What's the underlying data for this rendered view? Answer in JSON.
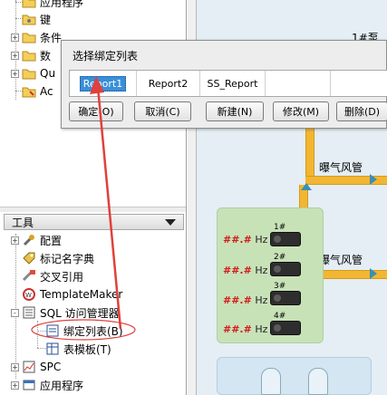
{
  "tree_top": {
    "items": [
      {
        "label": "应用程序",
        "expander": ""
      },
      {
        "label": "键",
        "expander": ""
      },
      {
        "label": "条件",
        "expander": "+"
      },
      {
        "label": "数",
        "expander": "+"
      },
      {
        "label": "Qu",
        "expander": "+"
      },
      {
        "label": "Ac",
        "expander": ""
      }
    ]
  },
  "tools_panel": {
    "header": "工具",
    "items": [
      {
        "label": "配置",
        "expander": "+"
      },
      {
        "label": "标记名字典",
        "expander": ""
      },
      {
        "label": "交叉引用",
        "expander": ""
      },
      {
        "label": "TemplateMaker",
        "expander": ""
      },
      {
        "label": "SQL 访问管理器",
        "expander": "-"
      },
      {
        "label": "绑定列表(B)",
        "expander": ""
      },
      {
        "label": "表模板(T)",
        "expander": ""
      },
      {
        "label": "SPC",
        "expander": "+"
      },
      {
        "label": "应用程序",
        "expander": "+"
      }
    ]
  },
  "dialog": {
    "title": "选择绑定列表",
    "list_items": [
      "Report1",
      "Report2",
      "SS_Report"
    ],
    "buttons": {
      "ok": "确定(O)",
      "cancel": "取消(C)",
      "new": "新建(N)",
      "modify": "修改(M)",
      "delete": "删除(D)"
    }
  },
  "diagram": {
    "top_label": "1#泵",
    "aeration_label_1": "曝气风管",
    "aeration_label_2": "曝气风管",
    "hz_readings": [
      {
        "prefix": "##.#",
        "unit": "Hz",
        "no": "1#"
      },
      {
        "prefix": "##.#",
        "unit": "Hz",
        "no": "2#"
      },
      {
        "prefix": "##.#",
        "unit": "Hz",
        "no": "3#"
      },
      {
        "prefix": "##.#",
        "unit": "Hz",
        "no": "4#"
      }
    ]
  },
  "colors": {
    "pipe": "#f2b632",
    "blue_pipe": "#4b9fc7",
    "selection": "#3a8fd8",
    "annotation": "#e0403c"
  }
}
